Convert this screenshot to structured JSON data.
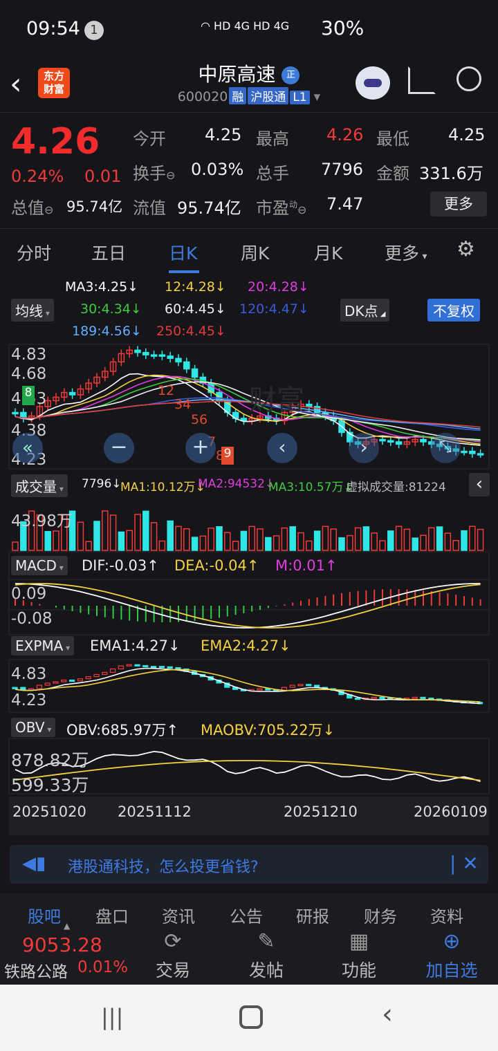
{
  "status": {
    "time": "09:54",
    "notif_count": "1",
    "signal": "HD 4G HD 4G",
    "battery": "30%"
  },
  "header": {
    "title": "中原高速",
    "title_badge": "正",
    "code": "600020",
    "tag1": "融",
    "tag2": "沪股通",
    "tag3": "L1",
    "logo_line1": "东方",
    "logo_line2": "财富"
  },
  "quote": {
    "price": "4.26",
    "change_pct": "0.24%",
    "change": "0.01",
    "open_label": "今开",
    "open": "4.25",
    "high_label": "最高",
    "high": "4.26",
    "low_label": "最低",
    "low": "4.25",
    "turnover_label": "换手",
    "turnover": "0.03%",
    "volume_label": "总手",
    "volume": "7796",
    "amount_label": "金额",
    "amount": "331.6万",
    "mktcap_label": "总值",
    "mktcap": "95.74亿",
    "float_label": "流值",
    "float": "95.74亿",
    "pe_label": "市盈",
    "pe_sup": "动",
    "pe": "7.47",
    "more": "更多"
  },
  "tabs": [
    "分时",
    "五日",
    "日K",
    "周K",
    "月K",
    "更多"
  ],
  "ma": {
    "ma3": "MA3:4.25↓",
    "ma12": "12:4.28↓",
    "ma20": "20:4.28↓",
    "selector": "均线",
    "ma30": "30:4.34↓",
    "ma60": "60:4.45↓",
    "ma120": "120:4.47↓",
    "dk": "DK点",
    "fq": "不复权",
    "ma189": "189:4.56↓",
    "ma250": "250:4.45↓"
  },
  "kline": {
    "y_top": "4.83",
    "y_2": "4.68",
    "y_3": "4.53",
    "y_4": "4.38",
    "y_bottom": "4.23",
    "markers": [
      "8",
      "1",
      "2",
      "3",
      "4",
      "5",
      "6",
      "7",
      "8",
      "9"
    ],
    "watermark": "财富"
  },
  "volume": {
    "selector": "成交量",
    "v": "7796↓",
    "ma1": "MA1:10.12万↓",
    "ma2": "MA2:94532↓",
    "ma3": "MA3:10.57万↓",
    "virtual": "虚拟成交量:81224",
    "y_top": "43.98万"
  },
  "macd": {
    "selector": "MACD",
    "dif": "DIF:-0.03↑",
    "dea": "DEA:-0.04↑",
    "m": "M:0.01↑",
    "y_top": "0.09",
    "y_bottom": "-0.08"
  },
  "expma": {
    "selector": "EXPMA",
    "ema1": "EMA1:4.27↓",
    "ema2": "EMA2:4.27↓",
    "y_top": "4.83",
    "y_bottom": "4.23"
  },
  "obv": {
    "selector": "OBV",
    "obv": "OBV:685.97万↑",
    "maobv": "MAOBV:705.22万↓",
    "y_top": "878.82万",
    "y_bottom": "599.33万"
  },
  "dates": [
    "20251020",
    "20251112",
    "20251210",
    "20260109"
  ],
  "ad": {
    "text": "港股通科技，怎么投更省钱?"
  },
  "subnav": [
    "股吧",
    "盘口",
    "资讯",
    "公告",
    "研报",
    "财务",
    "资料"
  ],
  "bottom": {
    "index_value": "9053.28",
    "index_name": "铁路公路",
    "index_change": "0.01%",
    "trade": "交易",
    "post": "发帖",
    "func": "功能",
    "watch": "加自选"
  },
  "colors": {
    "up": "#f23a3a",
    "down": "#2fe6e6",
    "accent": "#3d7be0",
    "bg": "#16161a"
  }
}
